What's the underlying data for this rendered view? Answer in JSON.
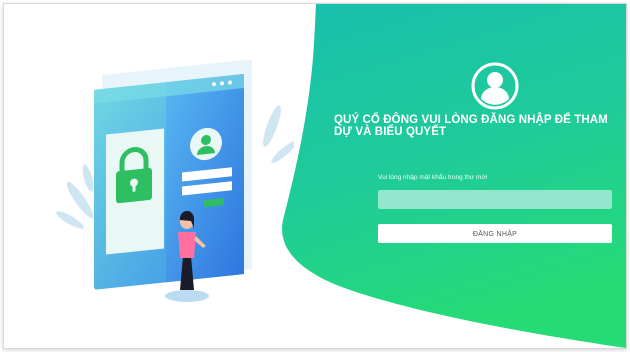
{
  "login": {
    "heading": "QUÝ CỔ ĐÔNG VUI LÒNG ĐĂNG NHẬP ĐỂ THAM DỰ VÀ BIỂU QUYẾT",
    "password_label": "Vui lòng nhập mật khẩu trong thư mời",
    "password_value": "",
    "submit_label": "ĐĂNG NHẬP"
  },
  "colors": {
    "panel_teal": "#1ec3a5",
    "panel_green": "#22d97e",
    "input_bg": "#92e7cc",
    "illustration_blue": "#3d9be8"
  },
  "icons": {
    "user": "user-avatar-icon",
    "lock": "padlock-icon"
  }
}
